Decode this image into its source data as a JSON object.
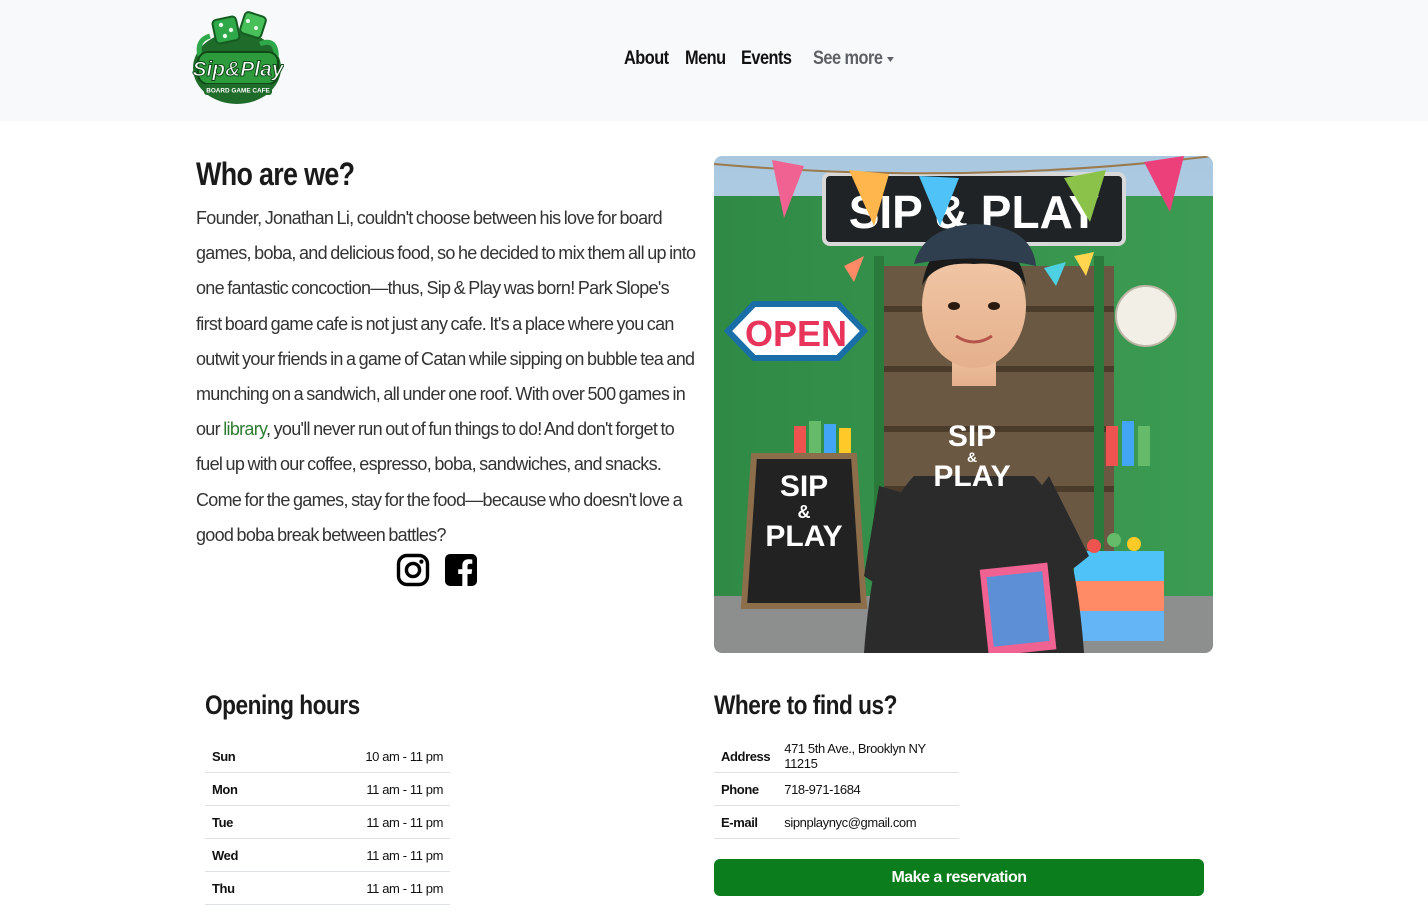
{
  "brand": {
    "logo_text": "Sip&Play",
    "logo_subtext": "BOARD GAME CAFE",
    "color": "#1e8a2e"
  },
  "nav": {
    "items": [
      {
        "label": "About"
      },
      {
        "label": "Menu"
      },
      {
        "label": "Events"
      }
    ],
    "more_label": "See more"
  },
  "about": {
    "title": "Who are we?",
    "text_before_link": "Founder, Jonathan Li, couldn't choose between his love for board games, boba, and delicious food, so he decided to mix them all up into one fantastic concoction—thus, Sip & Play was born! Park Slope's first board game cafe is not just any cafe. It's a place where you can outwit your friends in a game of Catan while sipping on bubble tea and munching on a sandwich, all under one roof. With over 500 games in our ",
    "link_label": "library",
    "text_after_link": ", you'll never run out of fun things to do! And don't forget to fuel up with our coffee, espresso, boba, sandwiches, and snacks. Come for the games, stay for the food—because who doesn't love a good boba break between battles?"
  },
  "social": {
    "icons": [
      "instagram-icon",
      "facebook-icon"
    ]
  },
  "hero": {
    "sign_text": "SIP & PLAY",
    "open_sign": "OPEN",
    "shirt_text": [
      "SIP",
      "&",
      "PLAY"
    ],
    "board_text": [
      "SIP",
      "&",
      "PLAY"
    ]
  },
  "hours": {
    "title": "Opening hours",
    "rows": [
      {
        "day": "Sun",
        "time": "10 am - 11 pm"
      },
      {
        "day": "Mon",
        "time": "11 am - 11 pm"
      },
      {
        "day": "Tue",
        "time": "11 am - 11 pm"
      },
      {
        "day": "Wed",
        "time": "11 am - 11 pm"
      },
      {
        "day": "Thu",
        "time": "11 am - 11 pm"
      }
    ]
  },
  "contact": {
    "title": "Where to find us?",
    "rows": [
      {
        "label": "Address",
        "value": "471 5th Ave., Brooklyn NY 11215"
      },
      {
        "label": "Phone",
        "value": "718-971-1684"
      },
      {
        "label": "E-mail",
        "value": "sipnplaynyc@gmail.com"
      }
    ]
  },
  "reserve_label": "Make a reservation",
  "colors": {
    "accent_green": "#0b7d1c",
    "link_green": "#2e7d32",
    "navbar_bg": "#f8f9fa"
  }
}
